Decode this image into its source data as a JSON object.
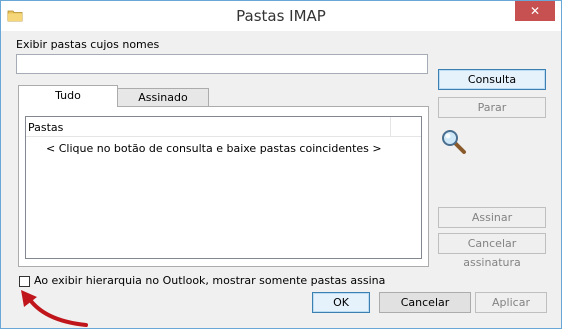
{
  "window": {
    "title": "Pastas IMAP",
    "close_glyph": "✕"
  },
  "filter": {
    "label": "Exibir pastas cujos nomes",
    "value": "",
    "placeholder": ""
  },
  "tabs": [
    {
      "label": "Tudo",
      "selected": true
    },
    {
      "label": "Assinado",
      "selected": false
    }
  ],
  "list": {
    "column_header": "Pastas",
    "empty_message": "< Clique no botão de consulta e baixe pastas coincidentes >"
  },
  "buttons": {
    "query": "Consulta",
    "stop": "Parar",
    "subscribe": "Assinar",
    "unsubscribe": "Cancelar assinatura",
    "ok": "OK",
    "cancel": "Cancelar",
    "apply": "Aplicar"
  },
  "hierarchy_option": {
    "label": "Ao exibir hierarquia no Outlook, mostrar somente pastas assina",
    "checked": false
  },
  "icons": {
    "app": "folder-icon",
    "search": "magnifier-icon",
    "annotation": "red-arrow-annotation"
  },
  "colors": {
    "accent_border": "#3c7fb1",
    "close": "#c75050",
    "annotation": "#c0161b"
  }
}
